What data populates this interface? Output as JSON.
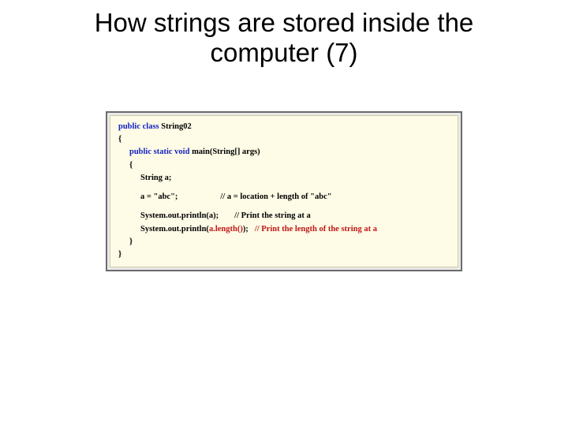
{
  "title": "How strings are stored inside the computer (7)",
  "code": {
    "l1_kw": "public class",
    "l1_rest": " String02",
    "l2": "{",
    "l3_kw": "public static void",
    "l3_rest": " main(String[] args)",
    "l4": "{",
    "l5": "String a;",
    "l6_a": "a = \"abc\";",
    "l6_c": "// a = location + length of \"abc\"",
    "l7_a": "System.out.println(a);",
    "l7_c": "// Print the string at a",
    "l8_a": "System.out.println(",
    "l8_hl": "a.length()",
    "l8_b": ");",
    "l8_c": "// Print the length of the string at a",
    "l9": "}",
    "l10": "}"
  }
}
